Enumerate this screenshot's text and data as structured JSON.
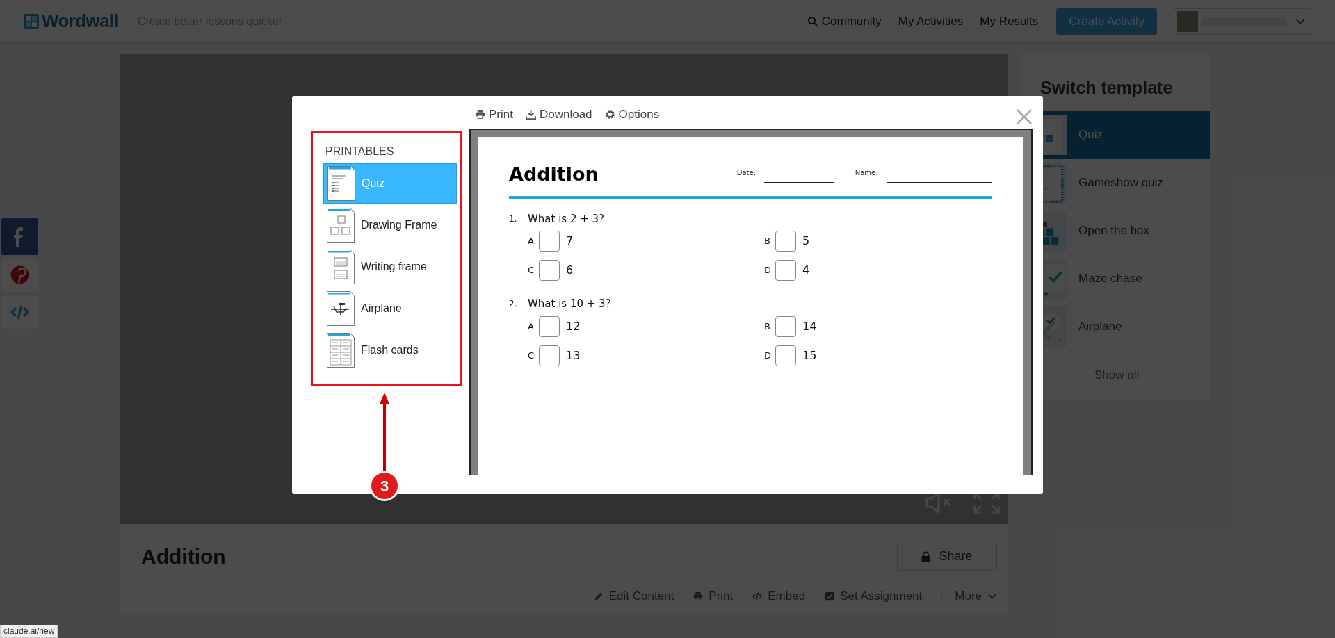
{
  "header": {
    "logo": "Wordwall",
    "tagline": "Create better lessons quicker",
    "nav": [
      {
        "label": "Community",
        "kind": "search"
      },
      {
        "label": "My Activities",
        "kind": "plain"
      },
      {
        "label": "My Results",
        "kind": "plain"
      }
    ],
    "create_button": "Create Activity"
  },
  "activity": {
    "title": "Addition",
    "share_button": "Share",
    "actions": [
      {
        "label": "Edit Content",
        "kind": "edit"
      },
      {
        "label": "Print",
        "kind": "print"
      },
      {
        "label": "Embed",
        "kind": "embed"
      },
      {
        "label": "Set Assignment",
        "kind": "assignment"
      },
      {
        "label": "More",
        "kind": "more"
      }
    ]
  },
  "sidebar": {
    "title": "Switch template",
    "items": [
      {
        "label": "Quiz",
        "kind": "quiz",
        "selected": true
      },
      {
        "label": "Gameshow quiz",
        "kind": "gameshow",
        "selected": false
      },
      {
        "label": "Open the box",
        "kind": "openbox",
        "selected": false
      },
      {
        "label": "Maze chase",
        "kind": "maze",
        "selected": false
      },
      {
        "label": "Airplane",
        "kind": "airplane",
        "selected": false
      }
    ],
    "show_all": "Show all"
  },
  "modal": {
    "toolbar": [
      {
        "label": "Print",
        "kind": "print"
      },
      {
        "label": "Download",
        "kind": "download"
      },
      {
        "label": "Options",
        "kind": "options"
      }
    ],
    "printables": {
      "heading": "PRINTABLES",
      "items": [
        {
          "label": "Quiz",
          "kind": "quiz",
          "selected": true
        },
        {
          "label": "Drawing Frame",
          "kind": "drawing",
          "selected": false
        },
        {
          "label": "Writing frame",
          "kind": "writing",
          "selected": false
        },
        {
          "label": "Airplane",
          "kind": "airplane",
          "selected": false
        },
        {
          "label": "Flash cards",
          "kind": "flashcards",
          "selected": false
        }
      ]
    },
    "worksheet": {
      "title": "Addition",
      "date_label": "Date:",
      "name_label": "Name:",
      "questions": [
        {
          "number": "1.",
          "text": "What is 2 + 3?",
          "options": [
            {
              "letter": "A",
              "answer": "7",
              "checked": false
            },
            {
              "letter": "B",
              "answer": "5",
              "checked": false
            },
            {
              "letter": "C",
              "answer": "6",
              "checked": false
            },
            {
              "letter": "D",
              "answer": "4",
              "checked": false
            }
          ]
        },
        {
          "number": "2.",
          "text": "What is 10 + 3?",
          "options": [
            {
              "letter": "A",
              "answer": "12",
              "checked": false
            },
            {
              "letter": "B",
              "answer": "14",
              "checked": false
            },
            {
              "letter": "C",
              "answer": "13",
              "checked": false
            },
            {
              "letter": "D",
              "answer": "15",
              "checked": false
            }
          ]
        }
      ]
    }
  },
  "annotation": {
    "number": "3"
  },
  "status_bar": "claude.ai/new"
}
